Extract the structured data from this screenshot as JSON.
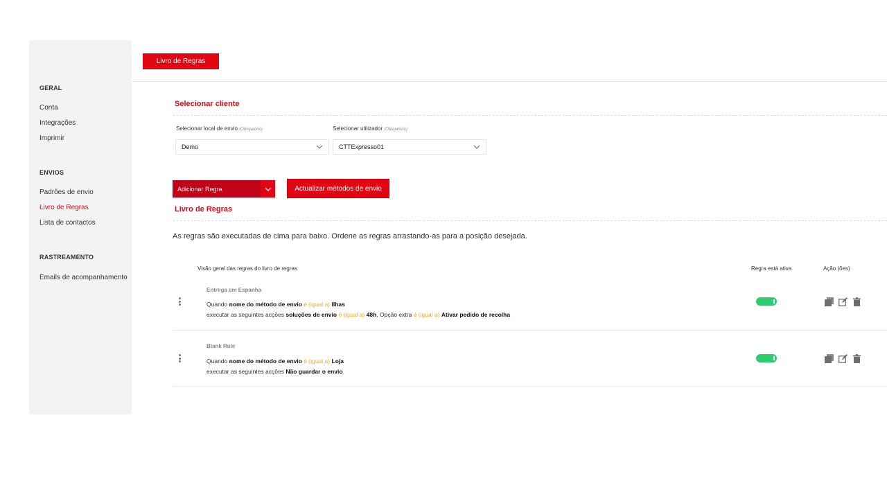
{
  "sidebar": {
    "sections": [
      {
        "title": "GERAL",
        "items": [
          "Conta",
          "Integrações",
          "Imprimir"
        ]
      },
      {
        "title": "ENVIOS",
        "items": [
          "Padrões de envio",
          "Livro de Regras",
          "Lista de contactos"
        ]
      },
      {
        "title": "RASTREAMENTO",
        "items": [
          "Emails de acompanhamento"
        ]
      }
    ],
    "active_item": "Livro de Regras"
  },
  "top_tab": {
    "label": "Livro de Regras"
  },
  "client_section": {
    "title": "Selecionar cliente",
    "shipping_location": {
      "label": "Selecionar local de envio",
      "required": "(Obrigatório)",
      "value": "Demo"
    },
    "user": {
      "label": "Selecionar utilizador",
      "required": "(Obrigatório)",
      "value": "CTTExpresso01"
    }
  },
  "actions": {
    "add_rule": "Adicionar Regra",
    "update_methods": "Actualizar métodos de envio"
  },
  "rulebook": {
    "title": "Livro de Regras",
    "description": "As regras são executadas de cima para baixo. Ordene as regras arrastando-as para a posição desejada.",
    "columns": {
      "overview": "Visão geral das regras do livro de regras",
      "active": "Regra está ativa",
      "actions": "Ação (ões)"
    },
    "rules": [
      {
        "name": "Entrega em Espanha",
        "when_prefix": "Quando",
        "when_field": "nome do método de envio",
        "when_op": "é (igual a)",
        "when_value": "Ilhas",
        "then_prefix": "executar as seguintes acções",
        "then_field1": "soluções de envio",
        "then_op1": "é (igual a)",
        "then_value1": "48h",
        "then_sep": ", Opção extra",
        "then_op2": "é (igual a)",
        "then_value2": "Ativar pedido de recolha",
        "active": true
      },
      {
        "name": "Blank Rule",
        "when_prefix": "Quando",
        "when_field": "nome do método de envio",
        "when_op": "é (igual a)",
        "when_value": "Loja",
        "then_prefix": "executar as seguintes acções",
        "then_action": "Não guardar o envio",
        "active": true
      }
    ]
  },
  "icons": {
    "drag": "drag-handle-icon",
    "duplicate": "duplicate-icon",
    "edit": "edit-icon",
    "delete": "trash-icon",
    "chevron": "chevron-down-icon"
  },
  "colors": {
    "brand_red": "#e20613",
    "operator_orange": "#f5a623",
    "toggle_green": "#2ecc71",
    "sidebar_bg": "#f2f3f4"
  }
}
